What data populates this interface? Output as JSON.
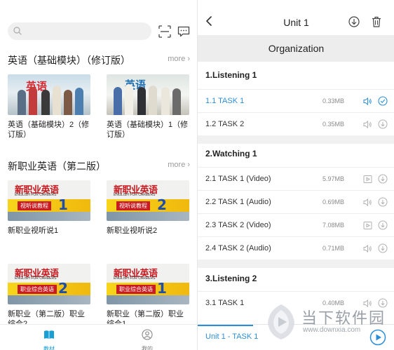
{
  "left": {
    "search": {
      "placeholder": ""
    },
    "sections": [
      {
        "title": "英语（基础模块）（修订版）",
        "more": "more",
        "books": [
          {
            "title": "英语（基础模块）2（修订版）",
            "cover_text": "英语"
          },
          {
            "title": "英语（基础模块）1（修订版）",
            "cover_text": "英语"
          }
        ]
      },
      {
        "title": "新职业英语（第二版）",
        "more": "more",
        "books": [
          {
            "title": "新职业视听说1",
            "cover_text": "新职业英语",
            "cover_sub": "ENGLISH FOR CAREERS",
            "cover_tag": "视听说教程",
            "cover_num": "1"
          },
          {
            "title": "新职业视听说2",
            "cover_text": "新职业英语",
            "cover_sub": "ENGLISH FOR CAREERS",
            "cover_tag": "视听说教程",
            "cover_num": "2"
          },
          {
            "title": "新职业（第二版）职业综合2",
            "cover_text": "新职业英语",
            "cover_sub": "ENGLISH FOR CAREERS",
            "cover_tag": "职业综合英语",
            "cover_num": "2"
          },
          {
            "title": "新职业（第二版）职业综合1",
            "cover_text": "新职业英语",
            "cover_sub": "ENGLISH FOR CAREERS",
            "cover_tag": "职业综合英语",
            "cover_num": "1"
          }
        ]
      }
    ],
    "tabbar": [
      {
        "label": "教材",
        "icon": "book-icon",
        "active": true
      },
      {
        "label": "我的",
        "icon": "person-icon",
        "active": false
      }
    ],
    "colors": {
      "accent": "#1a9fd4"
    }
  },
  "right": {
    "title": "Unit 1",
    "section_header": "Organization",
    "groups": [
      {
        "title": "1.Listening 1",
        "items": [
          {
            "name": "1.1 TASK 1",
            "size": "0.33MB",
            "icon1": "audio-icon",
            "icon2": "check-circle-icon",
            "active": true
          },
          {
            "name": "1.2 TASK 2",
            "size": "0.35MB",
            "icon1": "audio-icon",
            "icon2": "download-icon",
            "active": false
          }
        ]
      },
      {
        "title": "2.Watching 1",
        "items": [
          {
            "name": "2.1 TASK 1 (Video)",
            "size": "5.97MB",
            "icon1": "video-icon",
            "icon2": "download-icon",
            "active": false
          },
          {
            "name": "2.2 TASK 1 (Audio)",
            "size": "0.69MB",
            "icon1": "audio-icon",
            "icon2": "download-icon",
            "active": false
          },
          {
            "name": "2.3 TASK 2 (Video)",
            "size": "7.08MB",
            "icon1": "video-icon",
            "icon2": "download-icon",
            "active": false
          },
          {
            "name": "2.4 TASK 2 (Audio)",
            "size": "0.71MB",
            "icon1": "audio-icon",
            "icon2": "download-icon",
            "active": false
          }
        ]
      },
      {
        "title": "3.Listening 2",
        "items": [
          {
            "name": "3.1 TASK 1",
            "size": "0.40MB",
            "icon1": "audio-icon",
            "icon2": "download-icon",
            "active": false
          }
        ]
      }
    ],
    "player": {
      "now_playing": "Unit 1 - TASK 1",
      "progress": 0.28
    },
    "colors": {
      "accent": "#2b8ed6"
    }
  },
  "watermark": {
    "name": "当下软件园",
    "url": "www.downxia.com"
  }
}
